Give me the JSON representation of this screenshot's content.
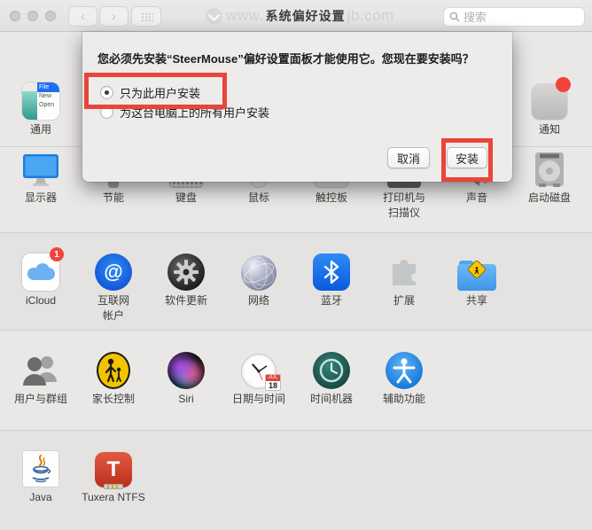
{
  "window": {
    "titlebar": {
      "title": "系统偏好设置",
      "watermark_prefix": "www.",
      "watermark_suffix": "jb.com",
      "search_placeholder": "搜索"
    }
  },
  "dialog": {
    "message": "您必须先安装“SteerMouse”偏好设置面板才能使用它。您现在要安装吗？",
    "radio_user_only": "只为此用户安装",
    "radio_all_users": "为这台电脑上的所有用户安装",
    "cancel_label": "取消",
    "install_label": "安装",
    "annotation_color": "#e8453b"
  },
  "grid": {
    "row1": {
      "general": "通用",
      "notifications": "通知"
    },
    "row2": [
      "显示器",
      "节能",
      "键盘",
      "鼠标",
      "触控板",
      "打印机与\n扫描仪",
      "声音",
      "启动磁盘"
    ],
    "row3": [
      "iCloud",
      "互联网\n帐户",
      "软件更新",
      "网络",
      "蓝牙",
      "扩展",
      "共享"
    ],
    "row4": [
      "用户与群组",
      "家长控制",
      "Siri",
      "日期与时间",
      "时间机器",
      "辅助功能"
    ],
    "row5": [
      "Java",
      "Tuxera NTFS"
    ]
  },
  "icons": {
    "icloud_badge": "1",
    "internet_at": "@",
    "general_menu_file": "File",
    "general_menu_new": "New",
    "general_menu_open": "Open",
    "calendar_month": "JUL",
    "calendar_day": "18",
    "tuxera_letter": "T"
  }
}
